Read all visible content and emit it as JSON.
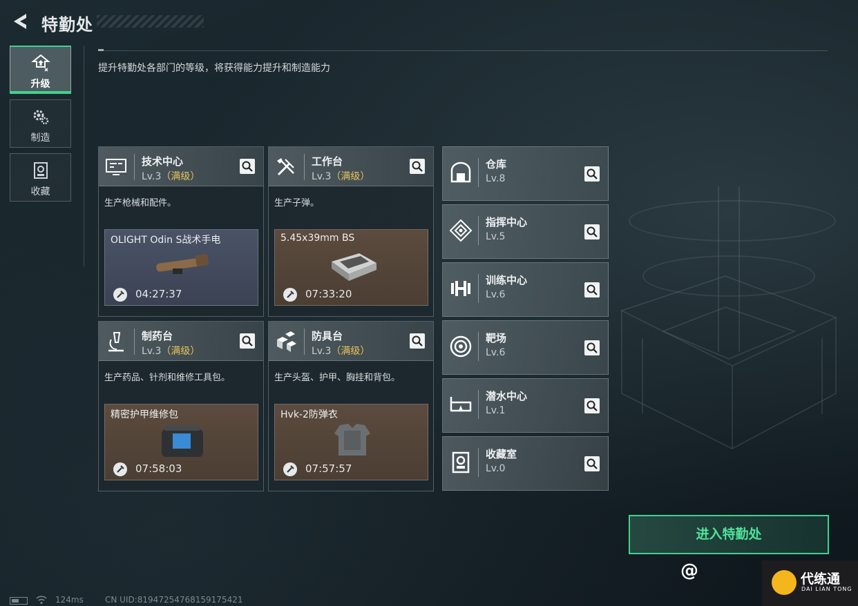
{
  "header": {
    "title": "特勤处"
  },
  "nav": [
    {
      "label": "升级",
      "icon": "upgrade-icon",
      "active": true
    },
    {
      "label": "制造",
      "icon": "gears-icon",
      "active": false
    },
    {
      "label": "收藏",
      "icon": "collection-icon",
      "active": false
    }
  ],
  "subtitle": "提升特勤处各部门的等级，将获得能力提升和制造能力",
  "production": [
    {
      "name": "技术中心",
      "level": "Lv.3",
      "max_tag": "（满级）",
      "desc": "生产枪械和配件。",
      "icon": "monitor-icon",
      "item": {
        "name": "OLIGHT Odin S战术手电",
        "timer": "04:27:37",
        "rarity": "blue"
      }
    },
    {
      "name": "工作台",
      "level": "Lv.3",
      "max_tag": "（满级）",
      "desc": "生产子弹。",
      "icon": "tools-icon",
      "item": {
        "name": "5.45x39mm BS",
        "timer": "07:33:20",
        "rarity": "brown"
      }
    },
    {
      "name": "制药台",
      "level": "Lv.3",
      "max_tag": "（满级）",
      "desc": "生产药品、针剂和维修工具包。",
      "icon": "microscope-icon",
      "item": {
        "name": "精密护甲维修包",
        "timer": "07:58:03",
        "rarity": "brown"
      }
    },
    {
      "name": "防具台",
      "level": "Lv.3",
      "max_tag": "（满级）",
      "desc": "生产头盔、护甲、胸挂和背包。",
      "icon": "armor-icon",
      "item": {
        "name": "Hvk-2防弹衣",
        "timer": "07:57:57",
        "rarity": "brown"
      }
    }
  ],
  "facilities": [
    {
      "name": "仓库",
      "level": "Lv.8",
      "icon": "warehouse-icon"
    },
    {
      "name": "指挥中心",
      "level": "Lv.5",
      "icon": "command-icon"
    },
    {
      "name": "训练中心",
      "level": "Lv.6",
      "icon": "dumbbell-icon"
    },
    {
      "name": "靶场",
      "level": "Lv.6",
      "icon": "target-icon"
    },
    {
      "name": "潜水中心",
      "level": "Lv.1",
      "icon": "goggles-icon"
    },
    {
      "name": "收藏室",
      "level": "Lv.0",
      "icon": "collection-icon"
    }
  ],
  "enter_button": "进入特勤处",
  "status": {
    "ping": "124ms",
    "uid": "CN UID:8194725476815917542​1"
  },
  "watermark": {
    "left": "@",
    "brand": "代练通",
    "sub": "DAI LIAN TONG"
  },
  "colors": {
    "accent": "#3fd38f",
    "max_level": "#e8c25a"
  }
}
